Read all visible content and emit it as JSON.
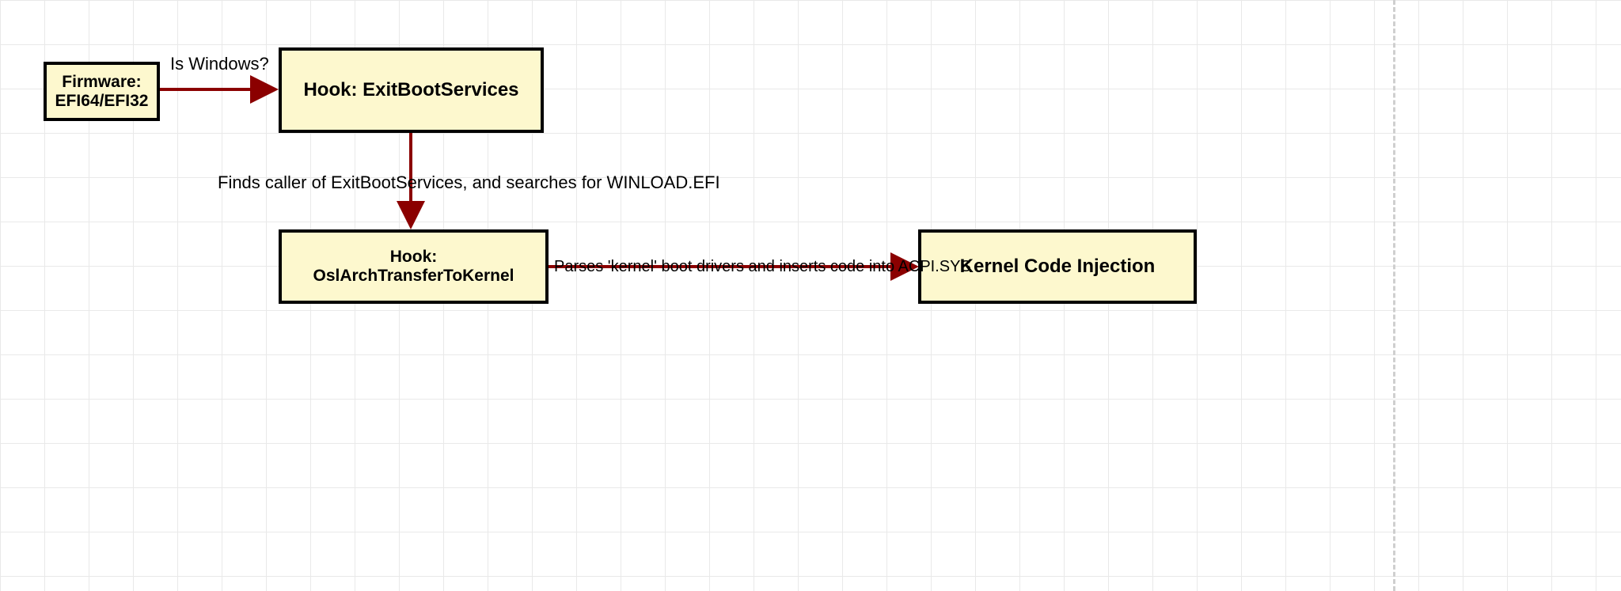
{
  "nodes": {
    "firmware": {
      "text": "Firmware:\nEFI64/EFI32"
    },
    "hook_ebs": {
      "text": "Hook: ExitBootServices"
    },
    "hook_osl": {
      "text": "Hook: OslArchTransferToKernel"
    },
    "kernel_inj": {
      "text": "Kernel Code Injection"
    }
  },
  "edges": {
    "is_windows": {
      "text": "Is Windows?"
    },
    "find_winload": {
      "text": "Finds caller of ExitBootServices, and searches for WINLOAD.EFI"
    },
    "parse_acpi": {
      "text": "Parses 'kernel' boot drivers and inserts code into ACPI.SYS"
    }
  },
  "colors": {
    "node_fill": "#FDF8CE",
    "node_stroke": "#000000",
    "arrow": "#8B0000"
  }
}
